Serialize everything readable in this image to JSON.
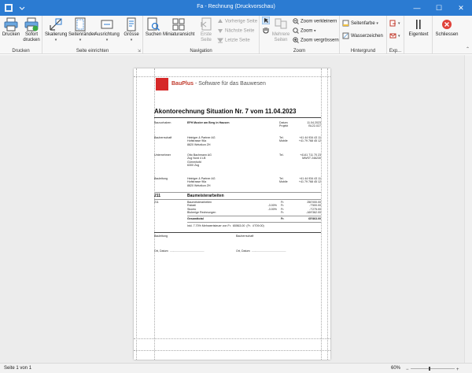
{
  "window": {
    "title": "Fa - Rechnung  (Druckvorschau)",
    "minimize_glyph": "—",
    "maximize_glyph": "☐",
    "close_glyph": "✕"
  },
  "ribbon": {
    "groups": {
      "drucken": "Drucken",
      "seite_einrichten": "Seite einrichten",
      "navigation": "Navigation",
      "zoom": "Zoom",
      "hintergrund": "Hintergrund",
      "exp": "Exp..."
    },
    "buttons": {
      "drucken": "Drucken",
      "sofort_drucken_1": "Sofort",
      "sofort_drucken_2": "drucken",
      "skalierung": "Skalierung",
      "seitenraender": "Seitenränder",
      "ausrichtung": "Ausrichtung",
      "groesse": "Grösse",
      "suchen": "Suchen",
      "miniaturansicht": "Miniaturansicht",
      "erste_seite_1": "Erste",
      "erste_seite_2": "Seite",
      "vorherige_seite": "Vorherige Seite",
      "naechste_seite": "Nächste Seite",
      "letzte_seite": "Letzte Seite",
      "mehrere_seiten_1": "Mehrere",
      "mehrere_seiten_2": "Seiten",
      "zoom_verkleinern": "Zoom verkleinern",
      "zoom": "Zoom",
      "zoom_vergroessern": "Zoom vergrössern",
      "seitenfarbe": "Seitenfarbe",
      "wasserzeichen": "Wasserzeichen",
      "eigentext": "Eigentext",
      "schliessen": "Schliessen"
    }
  },
  "document": {
    "logo_brand": "BauPlus",
    "logo_tagline": " - Software für das Bauwesen",
    "title": "Akontorechnung Situation Nr. 7 vom 11.04.2023",
    "bauvorhaben_label": "Bauvorhaben",
    "bauvorhaben_value": "EFH Muster am Berg in Hausen",
    "datum_label": "Datum\nProjekt",
    "datum_value": "11.04.2023\nBL22-027",
    "bauherrschaft_label": "Bauherrschaft",
    "bauherrschaft_address": "Heiniger & Partner AG\nHofstrasse 96a\n8820 Wetzikon ZH",
    "bauherrschaft_tel_label": "Tel.\nMobile",
    "bauherrschaft_tel": "+41 44 934 43 11\n+41 79 768 45 12",
    "unternehmer_label": "Unternehmer",
    "unternehmer_address": "Otto Bachmann AG\nZug Nord 4 LB\nGümmhofd\n6300 Zug",
    "unternehmer_tel_label": "Tel.",
    "unternehmer_tel": "+4141 711 70 23\nMWST 246230",
    "bauleitung_label": "Bauleitung",
    "bauleitung_address": "Heiniger & Partner AG\nHofstrasse 96a\n8820 Wetzikon ZH",
    "bauleitung_tel_label": "Tel.\nMobile",
    "bauleitung_tel": "+41 44 934 43 11\n+41 79 768 45 12",
    "section_nr": "211",
    "section_title": "Baumeisterarbeiten",
    "pos_nr": "211",
    "pos_lines": "Baumeisterarbeiten\nRabatt\nSkonto\nBisherige Rechnungen",
    "pos_percent": "\n-3.00%\n-3.00%",
    "pos_currency": "Fr.\nFr.\nFr.\nFr.",
    "pos_amounts": "250'000.00\n-7'500.00\n-7'275.00\n-169'362.00",
    "gesamttotal_label": "Gesamttotal",
    "gesamttotal_currency": "Fr.",
    "gesamttotal_value": "65'863.00",
    "mwst_note": "Inkl. 7.70% Mehrwertsteuer von Fr.  65'863.00  (Fr.  4'709.00)",
    "sign_left": "Bauleitung",
    "sign_right": "Bauherrschaft",
    "ort_left": "Ort, Datum  ............................................",
    "ort_right": "Ort, Datum  ............................................"
  },
  "statusbar": {
    "page_info": "Seite 1 von 1",
    "zoom_level": "60%"
  },
  "colors": {
    "titlebar": "#2b7bd2",
    "logo_red": "#d62828"
  }
}
